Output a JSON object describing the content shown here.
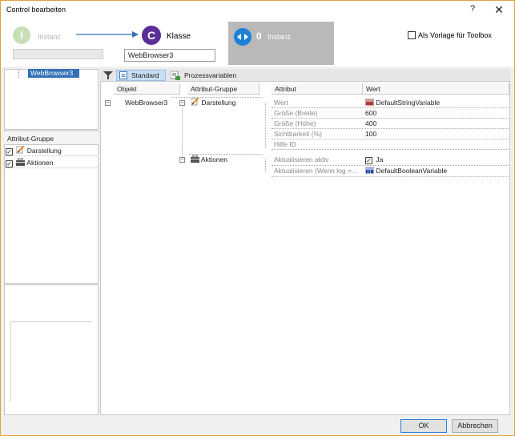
{
  "window": {
    "title": "Control bearbeiten",
    "help": "?",
    "close": "✕"
  },
  "header": {
    "instance_letter": "I",
    "instance_label": "Instanz",
    "class_letter": "C",
    "class_label": "Klasse",
    "class_name": "WebBrowser3",
    "instances_count": "0",
    "instances_label": "Instanz",
    "template_label": "Als Vorlage für Toolbox",
    "template_checked": false
  },
  "left": {
    "tree_item": "WebBrowser3",
    "group_header": "Attribut-Gruppe",
    "groups": [
      {
        "label": "Darstellung",
        "checked": true,
        "icon": "pencil-icon"
      },
      {
        "label": "Aktionen",
        "checked": true,
        "icon": "toolbox-icon"
      }
    ]
  },
  "toolbar": {
    "standard": "Standard",
    "process_vars": "Prozessvariablen"
  },
  "grid": {
    "columns": [
      "Objekt",
      "Attribut-Gruppe",
      "Attribut",
      "Wert"
    ],
    "object": "WebBrowser3",
    "groups": [
      {
        "label": "Darstellung",
        "rows": [
          {
            "attr": "Wert",
            "value": "DefaultStringVariable",
            "icon": "string-var-icon"
          },
          {
            "attr": "Größe (Breite)",
            "value": "600"
          },
          {
            "attr": "Größe (Höhe)",
            "value": "400"
          },
          {
            "attr": "Sichtbarkeit (%)",
            "value": "100"
          },
          {
            "attr": "Hilfe ID",
            "value": ""
          }
        ]
      },
      {
        "label": "Aktionen",
        "rows": [
          {
            "attr": "Aktualisieren aktiv",
            "value": "Ja",
            "checkbox": true
          },
          {
            "attr": "Aktualisieren (Wenn log =...",
            "value": "DefaultBooleanVariable",
            "icon": "bool-var-icon"
          }
        ]
      }
    ]
  },
  "buttons": {
    "ok": "OK",
    "cancel": "Abbrechen"
  },
  "colors": {
    "accent": "#3370b8",
    "class_purple": "#5b2f96",
    "instance_green": "#c7dfb6",
    "instances_blue": "#1a82d6"
  }
}
